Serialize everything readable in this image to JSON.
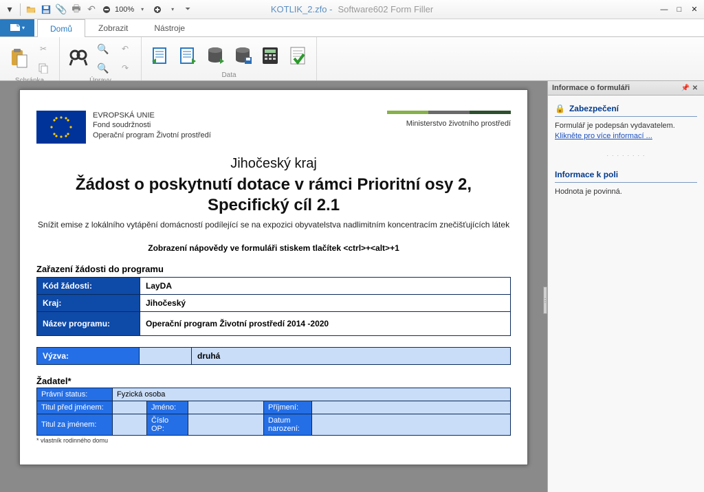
{
  "window": {
    "filename": "KOTLIK_2.zfo -",
    "appname": "Software602 Form Filler",
    "zoom": "100%"
  },
  "tabs": {
    "home": "Domů",
    "view": "Zobrazit",
    "tools": "Nástroje"
  },
  "ribbon_groups": {
    "clipboard": "Schránka",
    "edits": "Úpravy",
    "data": "Data"
  },
  "sidebar": {
    "title": "Informace o formuláři",
    "security_h": "Zabezpečení",
    "security_text": "Formulář je podepsán vydavatelem.",
    "security_link": "Klikněte pro více informací ...",
    "field_h": "Informace k poli",
    "field_text": "Hodnota je povinná."
  },
  "doc": {
    "eu_line1": "EVROPSKÁ UNIE",
    "eu_line2": "Fond soudržnosti",
    "eu_line3": "Operační program Životní prostředí",
    "ministry": "Ministerstvo životního prostředí",
    "region": "Jihočeský kraj",
    "title": "Žádost o poskytnutí dotace v rámci Prioritní osy 2, Specifický cíl 2.1",
    "subtitle": "Snížit emise z lokálního vytápění domácností podílející se na expozici obyvatelstva nadlimitním koncentracím znečišťujících látek",
    "help": "Zobrazení nápovědy ve formuláři stiskem tlačítek <ctrl>+<alt>+1",
    "sect1": "Zařazení žádosti do programu",
    "kod_l": "Kód žádosti:",
    "kod_v": "LayDA",
    "kraj_l": "Kraj:",
    "kraj_v": "Jihočeský",
    "prog_l": "Název programu:",
    "prog_v": "Operační program Životní prostředí 2014 -2020",
    "vyzva_l": "Výzva:",
    "vyzva_v": "druhá",
    "zadatel_h": "Žadatel*",
    "z_status_l": "Právní status:",
    "z_status_v": "Fyzická osoba",
    "z_titulpred_l": "Titul před jménem:",
    "z_jmeno_l": "Jméno:",
    "z_prijmeni_l": "Příjmení:",
    "z_titulza_l": "Titul za jménem:",
    "z_op_l": "Číslo OP:",
    "z_datum_l": "Datum narození:",
    "foot": "* vlastník rodinného domu"
  }
}
